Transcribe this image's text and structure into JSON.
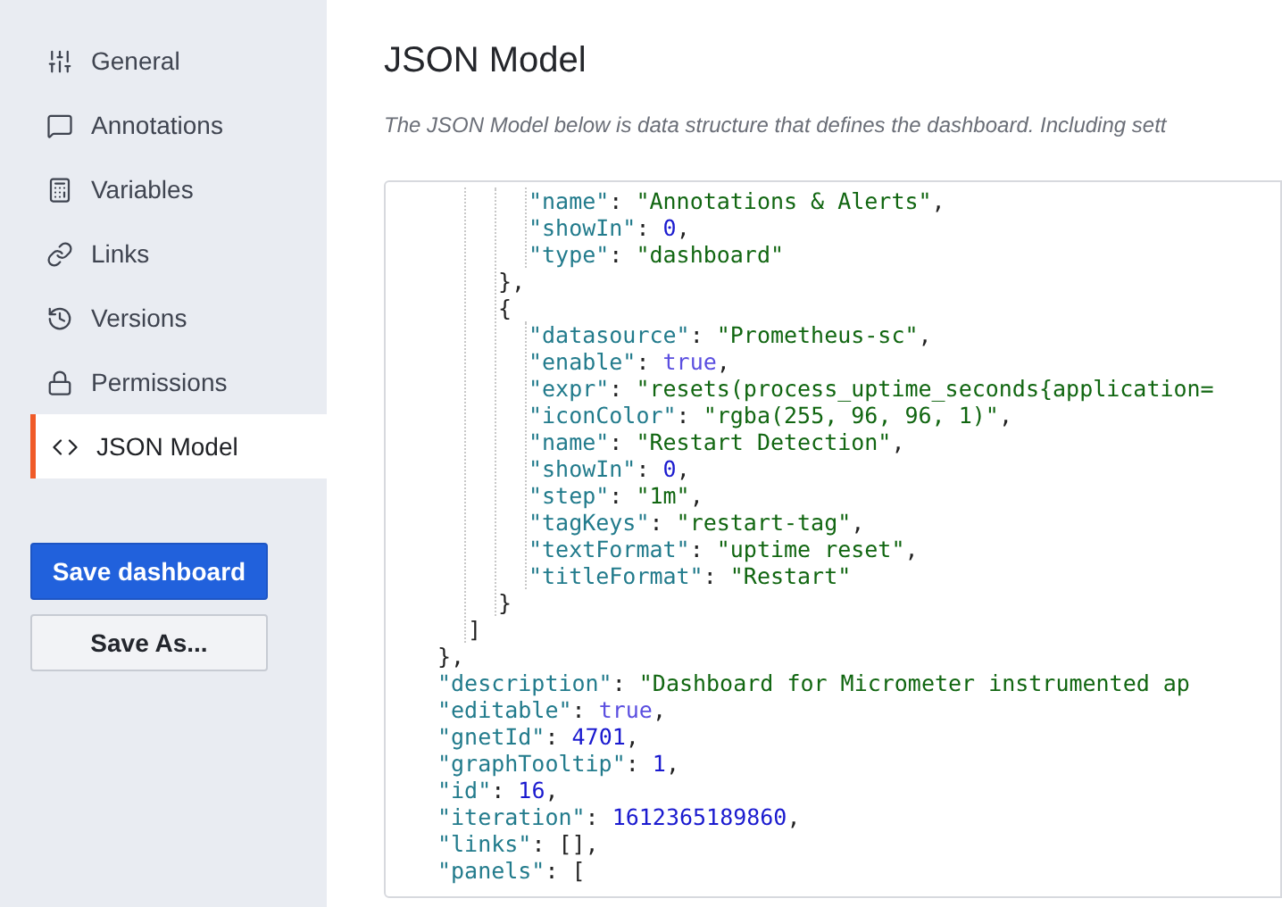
{
  "sidebar": {
    "items": [
      {
        "label": "General",
        "selected": false
      },
      {
        "label": "Annotations",
        "selected": false
      },
      {
        "label": "Variables",
        "selected": false
      },
      {
        "label": "Links",
        "selected": false
      },
      {
        "label": "Versions",
        "selected": false
      },
      {
        "label": "Permissions",
        "selected": false
      },
      {
        "label": "JSON Model",
        "selected": true
      }
    ],
    "buttons": [
      {
        "label": "Save dashboard",
        "kind": "primary"
      },
      {
        "label": "Save As...",
        "kind": "secondary"
      }
    ]
  },
  "page": {
    "title": "JSON Model",
    "description": "The JSON Model below is data structure that defines the dashboard. Including sett"
  },
  "editor": {
    "lines": [
      {
        "children": [
          {
            "children": [
              {
                "children": [
                  {
                    "tokens": [
                      {
                        "kind": "key",
                        "text": "\"name\""
                      },
                      {
                        "kind": "punct",
                        "text": ": "
                      },
                      {
                        "kind": "string",
                        "text": "\"Annotations & Alerts\""
                      },
                      {
                        "kind": "punct",
                        "text": ","
                      }
                    ]
                  },
                  {
                    "tokens": [
                      {
                        "kind": "key",
                        "text": "\"showIn\""
                      },
                      {
                        "kind": "punct",
                        "text": ": "
                      },
                      {
                        "kind": "number",
                        "text": "0"
                      },
                      {
                        "kind": "punct",
                        "text": ","
                      }
                    ]
                  },
                  {
                    "tokens": [
                      {
                        "kind": "key",
                        "text": "\"type\""
                      },
                      {
                        "kind": "punct",
                        "text": ": "
                      },
                      {
                        "kind": "string",
                        "text": "\"dashboard\""
                      }
                    ]
                  }
                ]
              },
              {
                "tokens": [
                  {
                    "kind": "punct",
                    "text": "},"
                  }
                ]
              },
              {
                "tokens": [
                  {
                    "kind": "punct",
                    "text": "{"
                  }
                ]
              },
              {
                "children": [
                  {
                    "tokens": [
                      {
                        "kind": "key",
                        "text": "\"datasource\""
                      },
                      {
                        "kind": "punct",
                        "text": ": "
                      },
                      {
                        "kind": "string",
                        "text": "\"Prometheus-sc\""
                      },
                      {
                        "kind": "punct",
                        "text": ","
                      }
                    ]
                  },
                  {
                    "tokens": [
                      {
                        "kind": "key",
                        "text": "\"enable\""
                      },
                      {
                        "kind": "punct",
                        "text": ": "
                      },
                      {
                        "kind": "bool",
                        "text": "true"
                      },
                      {
                        "kind": "punct",
                        "text": ","
                      }
                    ]
                  },
                  {
                    "tokens": [
                      {
                        "kind": "key",
                        "text": "\"expr\""
                      },
                      {
                        "kind": "punct",
                        "text": ": "
                      },
                      {
                        "kind": "string",
                        "text": "\"resets(process_uptime_seconds{application="
                      }
                    ]
                  },
                  {
                    "tokens": [
                      {
                        "kind": "key",
                        "text": "\"iconColor\""
                      },
                      {
                        "kind": "punct",
                        "text": ": "
                      },
                      {
                        "kind": "string",
                        "text": "\"rgba(255, 96, 96, 1)\""
                      },
                      {
                        "kind": "punct",
                        "text": ","
                      }
                    ]
                  },
                  {
                    "tokens": [
                      {
                        "kind": "key",
                        "text": "\"name\""
                      },
                      {
                        "kind": "punct",
                        "text": ": "
                      },
                      {
                        "kind": "string",
                        "text": "\"Restart Detection\""
                      },
                      {
                        "kind": "punct",
                        "text": ","
                      }
                    ]
                  },
                  {
                    "tokens": [
                      {
                        "kind": "key",
                        "text": "\"showIn\""
                      },
                      {
                        "kind": "punct",
                        "text": ": "
                      },
                      {
                        "kind": "number",
                        "text": "0"
                      },
                      {
                        "kind": "punct",
                        "text": ","
                      }
                    ]
                  },
                  {
                    "tokens": [
                      {
                        "kind": "key",
                        "text": "\"step\""
                      },
                      {
                        "kind": "punct",
                        "text": ": "
                      },
                      {
                        "kind": "string",
                        "text": "\"1m\""
                      },
                      {
                        "kind": "punct",
                        "text": ","
                      }
                    ]
                  },
                  {
                    "tokens": [
                      {
                        "kind": "key",
                        "text": "\"tagKeys\""
                      },
                      {
                        "kind": "punct",
                        "text": ": "
                      },
                      {
                        "kind": "string",
                        "text": "\"restart-tag\""
                      },
                      {
                        "kind": "punct",
                        "text": ","
                      }
                    ]
                  },
                  {
                    "tokens": [
                      {
                        "kind": "key",
                        "text": "\"textFormat\""
                      },
                      {
                        "kind": "punct",
                        "text": ": "
                      },
                      {
                        "kind": "string",
                        "text": "\"uptime reset\""
                      },
                      {
                        "kind": "punct",
                        "text": ","
                      }
                    ]
                  },
                  {
                    "tokens": [
                      {
                        "kind": "key",
                        "text": "\"titleFormat\""
                      },
                      {
                        "kind": "punct",
                        "text": ": "
                      },
                      {
                        "kind": "string",
                        "text": "\"Restart\""
                      }
                    ]
                  }
                ]
              },
              {
                "tokens": [
                  {
                    "kind": "punct",
                    "text": "}"
                  }
                ]
              }
            ]
          },
          {
            "tokens": [
              {
                "kind": "punct",
                "text": "]"
              }
            ]
          }
        ]
      },
      {
        "tokens": [
          {
            "kind": "punct",
            "text": "},"
          }
        ]
      },
      {
        "tokens": [
          {
            "kind": "key",
            "text": "\"description\""
          },
          {
            "kind": "punct",
            "text": ": "
          },
          {
            "kind": "string",
            "text": "\"Dashboard for Micrometer instrumented ap"
          }
        ]
      },
      {
        "tokens": [
          {
            "kind": "key",
            "text": "\"editable\""
          },
          {
            "kind": "punct",
            "text": ": "
          },
          {
            "kind": "bool",
            "text": "true"
          },
          {
            "kind": "punct",
            "text": ","
          }
        ]
      },
      {
        "tokens": [
          {
            "kind": "key",
            "text": "\"gnetId\""
          },
          {
            "kind": "punct",
            "text": ": "
          },
          {
            "kind": "number",
            "text": "4701"
          },
          {
            "kind": "punct",
            "text": ","
          }
        ]
      },
      {
        "tokens": [
          {
            "kind": "key",
            "text": "\"graphTooltip\""
          },
          {
            "kind": "punct",
            "text": ": "
          },
          {
            "kind": "number",
            "text": "1"
          },
          {
            "kind": "punct",
            "text": ","
          }
        ]
      },
      {
        "tokens": [
          {
            "kind": "key",
            "text": "\"id\""
          },
          {
            "kind": "punct",
            "text": ": "
          },
          {
            "kind": "number",
            "text": "16"
          },
          {
            "kind": "punct",
            "text": ","
          }
        ]
      },
      {
        "tokens": [
          {
            "kind": "key",
            "text": "\"iteration\""
          },
          {
            "kind": "punct",
            "text": ": "
          },
          {
            "kind": "number",
            "text": "1612365189860"
          },
          {
            "kind": "punct",
            "text": ","
          }
        ]
      },
      {
        "tokens": [
          {
            "kind": "key",
            "text": "\"links\""
          },
          {
            "kind": "punct",
            "text": ": "
          },
          {
            "kind": "punct",
            "text": "[],"
          }
        ]
      },
      {
        "tokens": [
          {
            "kind": "key",
            "text": "\"panels\""
          },
          {
            "kind": "punct",
            "text": ": "
          },
          {
            "kind": "punct",
            "text": "["
          }
        ]
      }
    ]
  }
}
